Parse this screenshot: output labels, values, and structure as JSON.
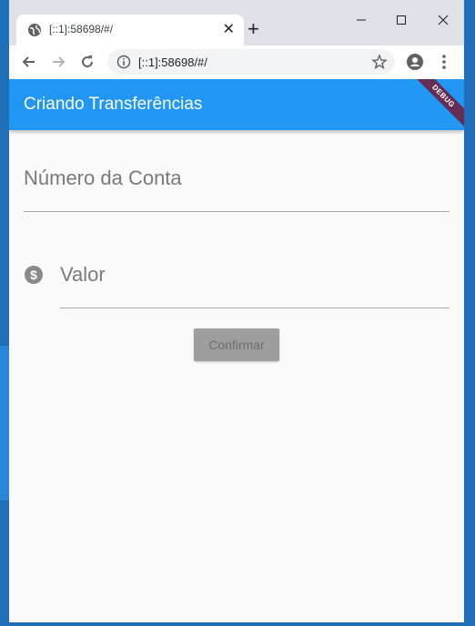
{
  "browser": {
    "tab_title": "[::1]:58698/#/",
    "tab_close": "✕",
    "new_tab": "+",
    "url": "[::1]:58698/#/"
  },
  "app": {
    "title": "Criando Transferências",
    "debug_banner": "DEBUG"
  },
  "form": {
    "account_label": "Número da Conta",
    "value_label": "Valor",
    "confirm_label": "Confirmar"
  },
  "colors": {
    "appbar": "#2196f3",
    "page_bg": "#fafafa",
    "button_disabled": "#9e9e9e"
  },
  "icons": {
    "favicon": "globe-icon",
    "value_field": "monetization-icon"
  }
}
